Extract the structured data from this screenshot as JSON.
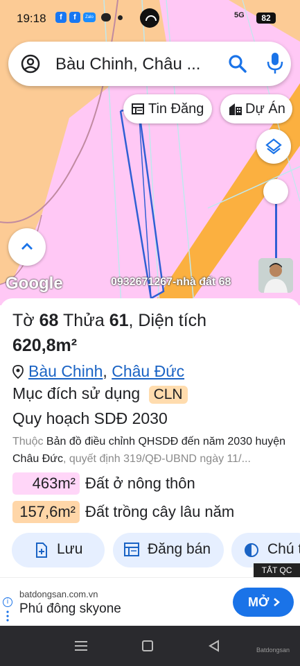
{
  "status_bar": {
    "time": "19:18",
    "network": "5G",
    "battery": "82"
  },
  "search": {
    "query": "Bàu Chinh, Châu ..."
  },
  "chips": {
    "tin_dang": "Tin Đăng",
    "du_an": "Dự Án"
  },
  "map": {
    "google_label": "Google",
    "watermark": "0932671267-nhà đất 68",
    "colors": {
      "land_pink": "#ffc8f5",
      "land_orange": "#fccb95",
      "road": "#fbb040",
      "parcel_line": "#2f5fd4"
    }
  },
  "parcel": {
    "label_to": "Tờ",
    "to_num": "68",
    "label_thua": "Thửa",
    "thua_num": "61",
    "label_dien_tich": ", Diện tích",
    "area": "620,8m²",
    "address": {
      "ward": "Bàu Chinh",
      "sep": ",",
      "district": "Châu Đức"
    },
    "purpose_label": "Mục đích sử dụng",
    "purpose_code": "CLN",
    "plan_label": "Quy hoạch SDĐ 2030",
    "note_prefix": "Thuộc",
    "note_text": "Bản đồ điều chỉnh QHSDĐ đến năm 2030 huyện Châu Đức",
    "note_suffix": ", quyết định 319/QĐ-UBND ngày 11/...",
    "areas": [
      {
        "value": "463m²",
        "label": "Đất ở nông thôn",
        "color": "#ffd6f8"
      },
      {
        "value": "157,6m²",
        "label": "Đất trồng cây lâu năm",
        "color": "#ffd6a8"
      }
    ]
  },
  "actions": {
    "save": "Lưu",
    "sell": "Đăng bán",
    "note": "Chú t"
  },
  "ad": {
    "hide_label": "TẮT QC",
    "domain": "batdongsan.com.vn",
    "title": "Phú đông skyone",
    "open_label": "MỞ"
  },
  "nav": {
    "brand": "Batdongsan"
  }
}
